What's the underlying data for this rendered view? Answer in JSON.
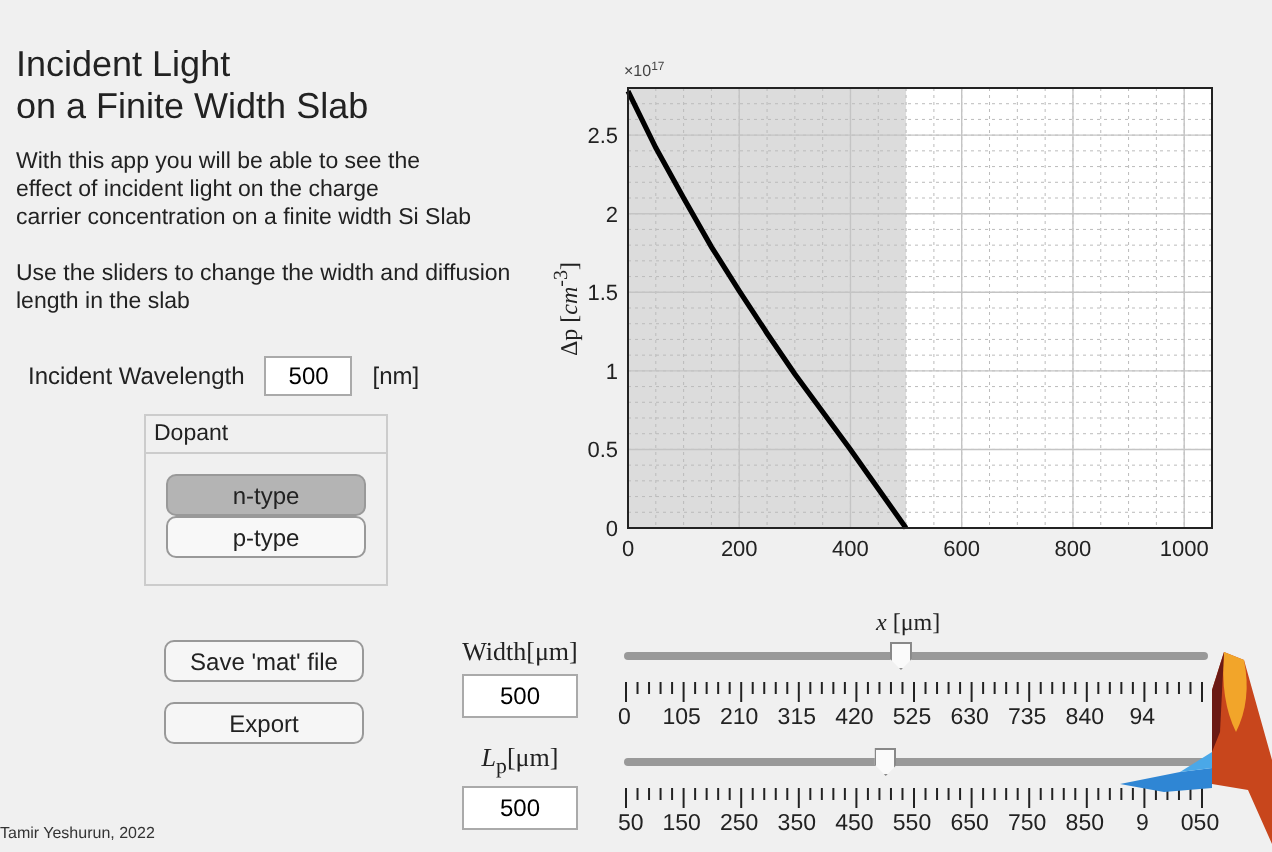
{
  "title": "Incident Light\non a Finite Width Slab",
  "description": "With this app you will be able to see the\neffect of incident light on the charge\ncarrier concentration on a finite width Si Slab\n\nUse the sliders to change the width and diffusion\nlength in the slab",
  "wavelength": {
    "label": "Incident Wavelength",
    "value": "500",
    "unit": "[nm]"
  },
  "dopant": {
    "title": "Dopant",
    "options": [
      {
        "label": "n-type",
        "selected": true
      },
      {
        "label": "p-type",
        "selected": false
      }
    ]
  },
  "chart": {
    "exponent": "×10$^{17}$",
    "chart_data": {
      "type": "line",
      "xlabel": "*x* [μm]",
      "ylabel": "Δp [*cm*$^{-3}$]",
      "grid": true,
      "x": [
        0,
        50,
        100,
        150,
        200,
        250,
        300,
        350,
        400,
        450,
        500
      ],
      "series": [
        {
          "color": "#000000",
          "values": [
            2.78,
            2.42,
            2.1,
            1.79,
            1.51,
            1.24,
            0.98,
            0.74,
            0.5,
            0.25,
            0
          ]
        }
      ],
      "xlim": [
        0,
        1050
      ],
      "ylim": [
        0,
        2.8
      ],
      "xticks": [
        {
          "value": 0,
          "label": "0"
        },
        {
          "value": 200,
          "label": "200"
        },
        {
          "value": 400,
          "label": "400"
        },
        {
          "value": 600,
          "label": "600"
        },
        {
          "value": 800,
          "label": "800"
        },
        {
          "value": 1000,
          "label": "1000"
        }
      ],
      "yticks": [
        {
          "value": 0,
          "label": "0"
        },
        {
          "value": 0.5,
          "label": "0.5"
        },
        {
          "value": 1,
          "label": "1"
        },
        {
          "value": 1.5,
          "label": "1.5"
        },
        {
          "value": 2,
          "label": "2"
        },
        {
          "value": 2.5,
          "label": "2.5"
        }
      ],
      "bands": [
        {
          "axis": "x",
          "from": 0,
          "to": 500
        }
      ]
    }
  },
  "buttons": [
    "Save 'mat' file",
    "Export"
  ],
  "sliders": [
    {
      "label": "Width[μm]",
      "value": "500",
      "level": 0.476,
      "tick_labels": [
        "0",
        "105",
        "210",
        "315",
        "420",
        "525",
        "630",
        "735",
        "840",
        "94"
      ]
    },
    {
      "label": "*L*$_{p}$[μm]",
      "value": "500",
      "level": 0.45,
      "tick_labels": [
        "50",
        "150",
        "250",
        "350",
        "450",
        "550",
        "650",
        "750",
        "850",
        "9",
        "050"
      ]
    }
  ],
  "footer": "Tamir Yeshurun, 2022"
}
